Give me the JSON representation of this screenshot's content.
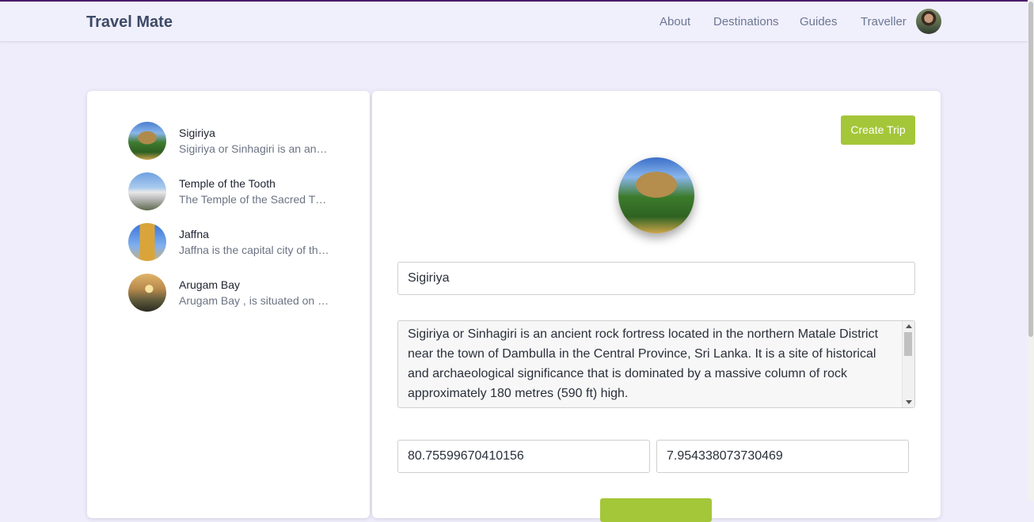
{
  "navbar": {
    "brand": "Travel Mate",
    "links": [
      "About",
      "Destinations",
      "Guides",
      "Traveller"
    ],
    "avatar_icon": "user-avatar"
  },
  "destinations": [
    {
      "name": "Sigiriya",
      "description": "Sigiriya or Sinhagiri is an an…"
    },
    {
      "name": "Temple of the Tooth",
      "description": "The Temple of the Sacred T…"
    },
    {
      "name": "Jaffna",
      "description": "Jaffna is the capital city of th…"
    },
    {
      "name": "Arugam Bay",
      "description": "Arugam Bay , is situated on …"
    }
  ],
  "detail": {
    "create_button": "Create Trip",
    "name_value": "Sigiriya",
    "description_value": "Sigiriya or Sinhagiri is an ancient rock fortress located in the northern Matale District near the town of Dambulla in the Central Province, Sri Lanka. It is a site of historical and archaeological significance that is dominated by a massive column of rock approximately 180 metres (590 ft) high.",
    "longitude_value": "80.75599670410156",
    "latitude_value": "7.954338073730469"
  },
  "colors": {
    "accent": "#a4c639",
    "brand_text": "#3d4a66",
    "page_background": "#efedfb"
  }
}
